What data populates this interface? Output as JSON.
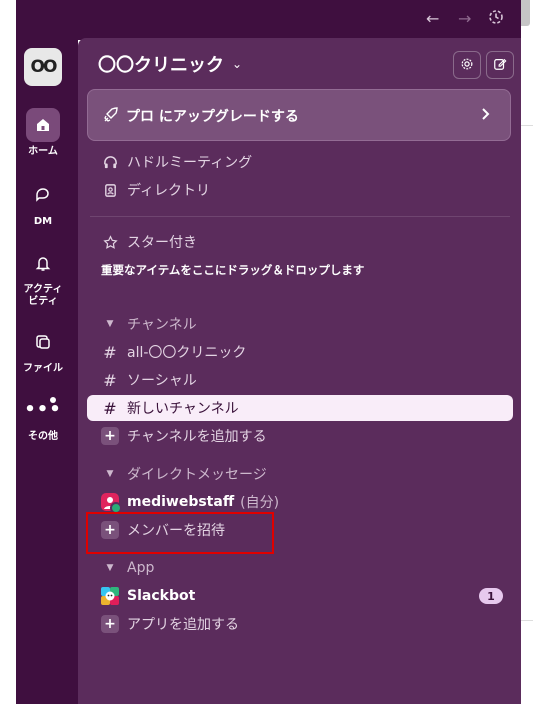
{
  "workspace": {
    "logo_text": "OO",
    "title": "〇〇クリニック"
  },
  "rail": [
    {
      "label": "ホーム",
      "icon": "home-icon",
      "active": true
    },
    {
      "label": "DM",
      "icon": "dm-icon"
    },
    {
      "label": "アクティビティ",
      "icon": "bell-icon"
    },
    {
      "label": "ファイル",
      "icon": "files-icon"
    },
    {
      "label": "その他",
      "icon": "more-icon"
    }
  ],
  "upgrade": {
    "label": "プロ にアップグレードする"
  },
  "nav": [
    {
      "label": "ハドルミーティング",
      "icon": "headphones-icon"
    },
    {
      "label": "ディレクトリ",
      "icon": "directory-icon"
    }
  ],
  "starred": {
    "label": "スター付き",
    "hint": "重要なアイテムをここにドラッグ＆ドロップします"
  },
  "channels": {
    "section_label": "チャンネル",
    "items": [
      {
        "name": "all-〇〇クリニック"
      },
      {
        "name": "ソーシャル"
      },
      {
        "name": "新しいチャンネル",
        "selected": true
      }
    ],
    "add_label": "チャンネルを追加する"
  },
  "dms": {
    "section_label": "ダイレクトメッセージ",
    "self_name": "mediwebstaff",
    "self_suffix": "(自分)",
    "invite_label": "メンバーを招待"
  },
  "apps": {
    "section_label": "App",
    "slackbot": "Slackbot",
    "slackbot_badge": "1",
    "add_label": "アプリを追加する"
  },
  "colors": {
    "rail_bg": "#3f0f3f",
    "sidebar_bg": "#5b2c5c",
    "highlight": "#e00000"
  }
}
